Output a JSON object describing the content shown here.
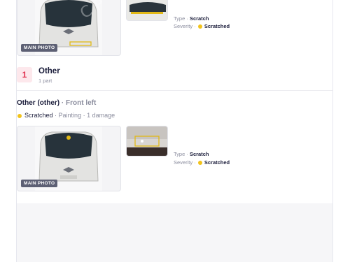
{
  "colors": {
    "accent_red": "#e0324f",
    "badge_bg": "#fde8ec",
    "severity_yellow": "#f2c31b",
    "muted": "#8b8d9e",
    "text": "#1a1c3a"
  },
  "top_item": {
    "main_photo_label": "MAIN PHOTO",
    "type_label": "Type ·",
    "type_value": "Scratch",
    "severity_label": "Severity ·",
    "severity_value": "Scratched"
  },
  "group": {
    "count": "1",
    "title": "Other",
    "subtitle": "1 part"
  },
  "part": {
    "name": "Other (other)",
    "location": "· Front left",
    "severity": "Scratched",
    "operation": "· Painting",
    "damage_count": "· 1 damage",
    "main_photo_label": "MAIN PHOTO",
    "type_label": "Type ·",
    "type_value": "Scratch",
    "severity_label": "Severity ·",
    "severity_value": "Scratched"
  }
}
